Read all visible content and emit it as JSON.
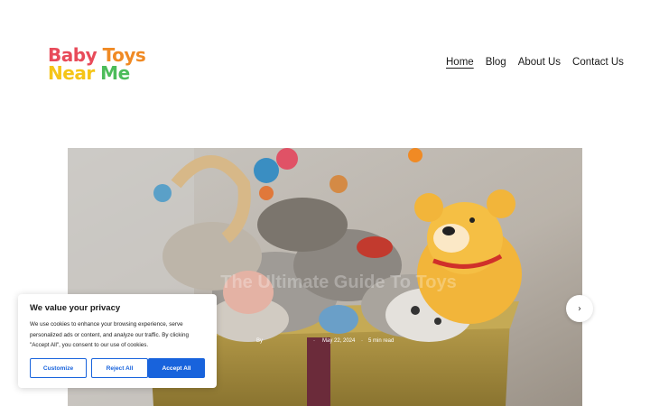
{
  "logo": {
    "line1": [
      {
        "t": "B",
        "c": "#e84b5a"
      },
      {
        "t": "a",
        "c": "#e84b5a"
      },
      {
        "t": "b",
        "c": "#e84b5a"
      },
      {
        "t": "y",
        "c": "#e84b5a"
      },
      {
        "t": " ",
        "c": "#000"
      },
      {
        "t": "T",
        "c": "#f08a24"
      },
      {
        "t": "o",
        "c": "#f08a24"
      },
      {
        "t": "y",
        "c": "#f08a24"
      },
      {
        "t": "s",
        "c": "#f08a24"
      }
    ],
    "line2": [
      {
        "t": "N",
        "c": "#f5c518"
      },
      {
        "t": "e",
        "c": "#f5c518"
      },
      {
        "t": "a",
        "c": "#f5c518"
      },
      {
        "t": "r",
        "c": "#f5c518"
      },
      {
        "t": " ",
        "c": "#000"
      },
      {
        "t": "M",
        "c": "#4cbc5a"
      },
      {
        "t": "e",
        "c": "#4cbc5a"
      }
    ]
  },
  "nav": {
    "items": [
      {
        "label": "Home",
        "active": true
      },
      {
        "label": "Blog",
        "active": false
      },
      {
        "label": "About Us",
        "active": false
      },
      {
        "label": "Contact Us",
        "active": false
      }
    ]
  },
  "hero": {
    "title": "The Ultimate Guide To Toys",
    "author_prefix": "By",
    "date": "May 22, 2024",
    "read_time": "5 min read",
    "next_icon": "chevron-right-icon"
  },
  "cookie": {
    "title": "We value your privacy",
    "text": "We use cookies to enhance your browsing experience, serve personalized ads or content, and analyze our traffic. By clicking \"Accept All\", you consent to our use of cookies.",
    "customize_label": "Customize",
    "reject_label": "Reject All",
    "accept_label": "Accept All",
    "accent": "#1863dc"
  }
}
